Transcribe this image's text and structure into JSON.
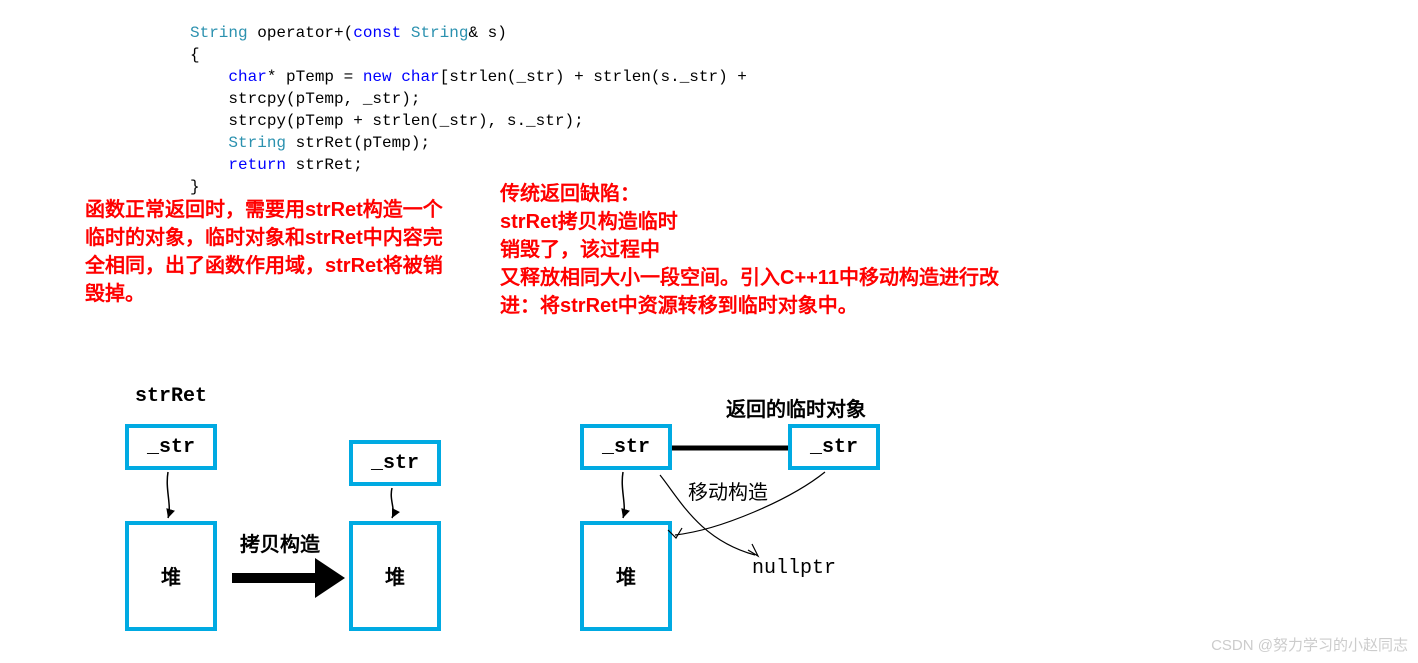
{
  "code": {
    "line1_pre": "String",
    "line1_mid": " operator+(",
    "line1_const": "const",
    "line1_type2": " String",
    "line1_rest": "& s)",
    "line2": "{",
    "line3_a": "    char",
    "line3_b": "* pTemp = ",
    "line3_c": "new",
    "line3_d": " char",
    "line3_e": "[strlen(_str) + strlen(s._str) +",
    "line4": "    strcpy(pTemp, _str);",
    "line5": "    strcpy(pTemp + strlen(_str), s._str);",
    "line6_a": "    String",
    "line6_b": " strRet(pTemp);",
    "line7_a": "    return",
    "line7_b": " strRet;",
    "line8": "}"
  },
  "annotations": {
    "left": "函数正常返回时，需要用strRet构造一个临时的对象，临时对象和strRet中内容完全相同，出了函数作用域，strRet将被销毁掉。",
    "right": "传统返回缺陷：\nstrRet拷贝构造临时\n销毁了，该过程中\n又释放相同大小一段空间。引入C++11中移动构造进行改进：将strRet中资源转移到临时对象中。"
  },
  "diagram": {
    "label_strret": "strRet",
    "label_str": "_str",
    "label_heap": "堆",
    "label_copy": "拷贝构造",
    "label_return_temp": "返回的临时对象",
    "label_move": "移动构造",
    "label_nullptr": "nullptr"
  },
  "watermark": "CSDN @努力学习的小赵同志"
}
